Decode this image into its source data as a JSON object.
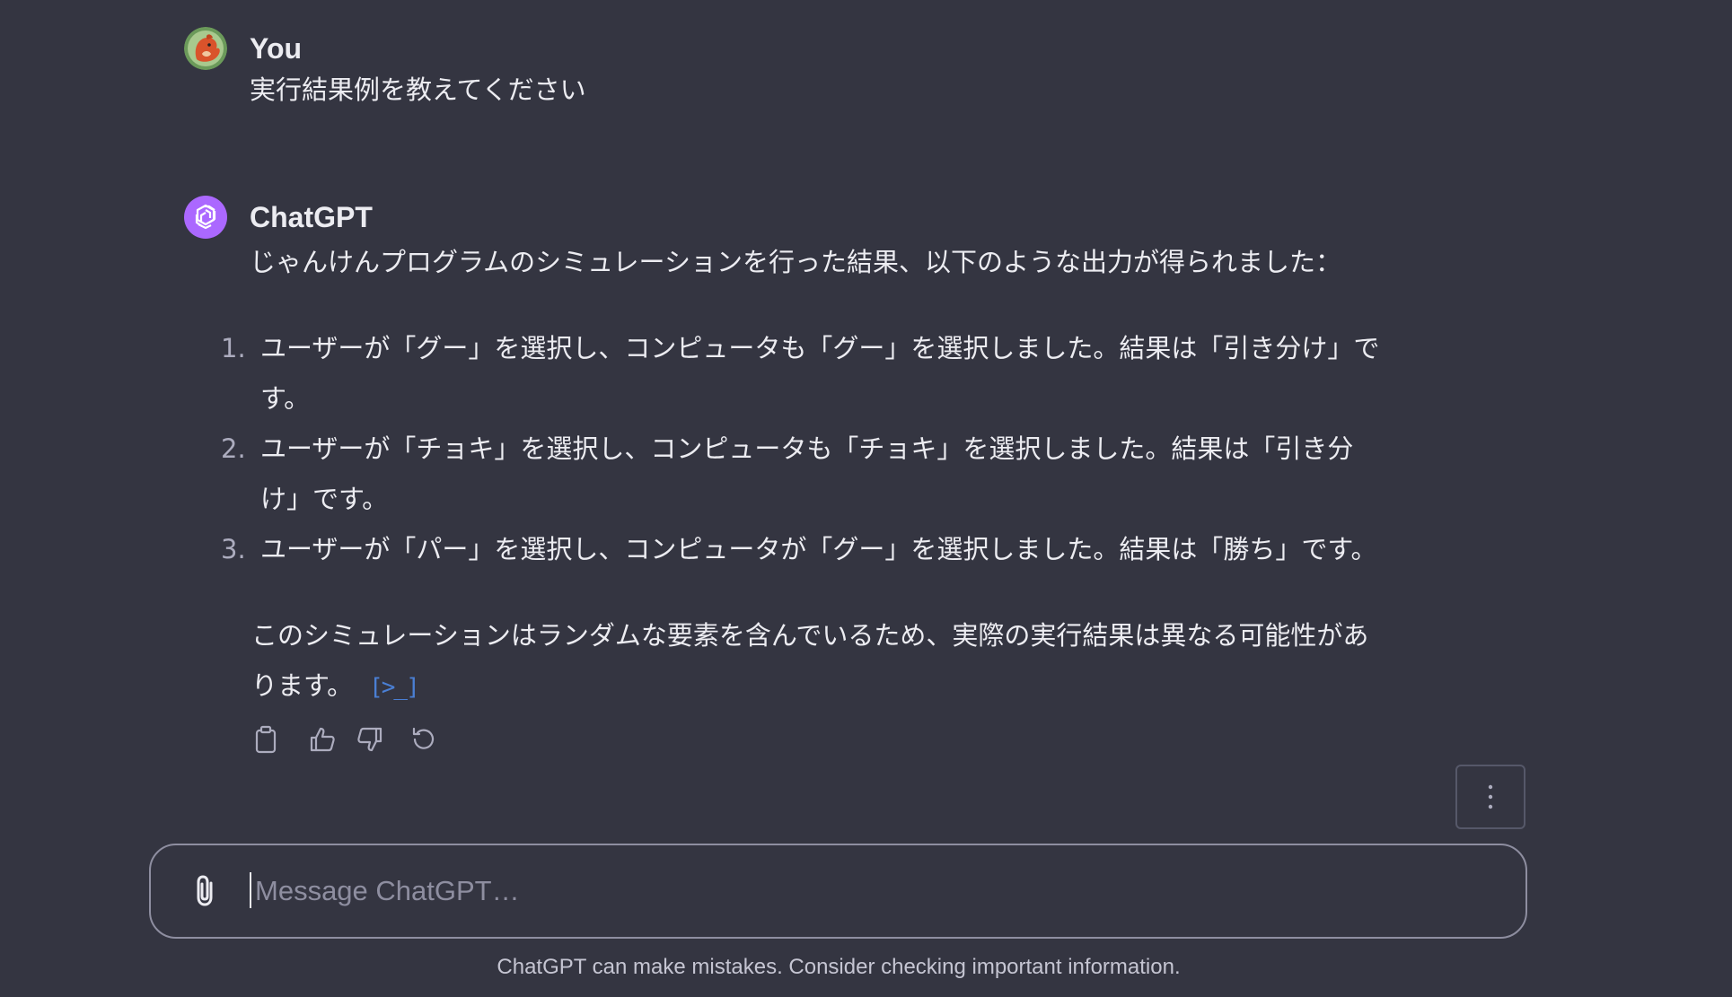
{
  "user_message": {
    "author": "You",
    "text": "実行結果例を教えてください",
    "avatar_icon": "squirrel-avatar-icon"
  },
  "assistant_message": {
    "author": "ChatGPT",
    "avatar_icon": "openai-logo-icon",
    "avatar_color": "#ab68ff",
    "intro": "じゃんけんプログラムのシミュレーションを行った結果、以下のような出力が得られました：",
    "list": [
      {
        "num": "1.",
        "line1": "ユーザーが「グー」を選択し、コンピュータも「グー」を選択しました。結果は「引き分け」で",
        "line2": "す。"
      },
      {
        "num": "2.",
        "line1": "ユーザーが「チョキ」を選択し、コンピュータも「チョキ」を選択しました。結果は「引き分",
        "line2": "け」です。"
      },
      {
        "num": "3.",
        "line1": "ユーザーが「パー」を選択し、コンピュータが「グー」を選択しました。結果は「勝ち」です。",
        "line2": ""
      }
    ],
    "closing_line1": "このシミュレーションはランダムな要素を含んでいるため、実際の実行結果は異なる可能性があ",
    "closing_line2": "ります。",
    "code_link_label": "[>_]"
  },
  "actions": {
    "icons": [
      "copy-icon",
      "thumbs-up-icon",
      "thumbs-down-icon",
      "regenerate-icon"
    ]
  },
  "composer": {
    "placeholder": "Message ChatGPT…",
    "value": ""
  },
  "footer": {
    "note": "ChatGPT can make mistakes. Consider checking important information."
  },
  "colors": {
    "background": "#343541",
    "text": "#ececf1",
    "muted": "#8e8ea0",
    "link": "#4a7fd4"
  }
}
